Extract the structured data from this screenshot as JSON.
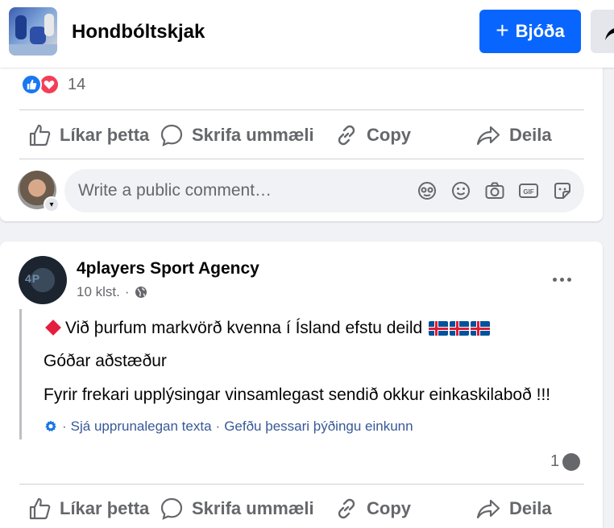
{
  "header": {
    "group_name": "Hondbóltskjak",
    "invite_label": "Bjóða",
    "invite_plus": "+"
  },
  "post1": {
    "reaction_count": "14",
    "actions": {
      "like": "Líkar þetta",
      "comment": "Skrifa ummæli",
      "copy": "Copy",
      "share": "Deila"
    },
    "comment_placeholder": "Write a public comment…",
    "comment_icons": [
      "avatar-sticker-icon",
      "emoji-icon",
      "camera-icon",
      "gif-icon",
      "sticker-icon"
    ]
  },
  "post2": {
    "page_name": "4players Sport Agency",
    "time": "10 klst.",
    "dot": "·",
    "body": {
      "line1": "Við þurfum markvörð kvenna í Ísland efstu deild",
      "line2": "Góðar aðstæður",
      "line3": "Fyrir frekari upplýsingar vinsamlegast sendið okkur einkaskilaboð !!!"
    },
    "translate": {
      "see_original": "Sjá upprunalegan texta",
      "rate": "Gefðu þessari þýðingu einkunn",
      "sep": "·"
    },
    "comment_count": "1",
    "actions": {
      "like": "Líkar þetta",
      "comment": "Skrifa ummæli",
      "copy": "Copy",
      "share": "Deila"
    }
  },
  "colors": {
    "brand_blue": "#0866ff",
    "like_blue": "#1877f2",
    "love_red": "#f33e58",
    "secondary_text": "#65676b"
  }
}
